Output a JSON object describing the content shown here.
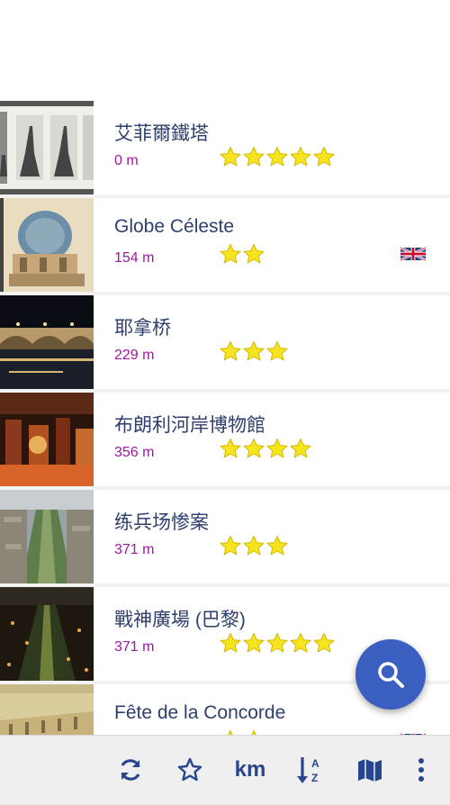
{
  "places": [
    {
      "name": "艾菲爾鐵塔",
      "distance": "0 m",
      "rating": 5,
      "flag": ""
    },
    {
      "name": "Globe Céleste",
      "distance": "154 m",
      "rating": 2,
      "flag": "uk-flag-icon"
    },
    {
      "name": "耶拿桥",
      "distance": "229 m",
      "rating": 3,
      "flag": ""
    },
    {
      "name": "布朗利河岸博物館",
      "distance": "356 m",
      "rating": 4,
      "flag": ""
    },
    {
      "name": "练兵场惨案",
      "distance": "371 m",
      "rating": 3,
      "flag": ""
    },
    {
      "name": "戰神廣場 (巴黎)",
      "distance": "371 m",
      "rating": 5,
      "flag": ""
    },
    {
      "name": "Fête de la Concorde",
      "distance": "",
      "rating": 2,
      "flag": "uk-flag-icon"
    }
  ],
  "toolbar": {
    "units_label": "km",
    "icons": [
      "refresh-icon",
      "star-outline-icon",
      "sort-az-icon",
      "map-icon",
      "more-vert-icon"
    ]
  },
  "fab_icon": "search-icon",
  "colors": {
    "title": "#2e3f6e",
    "distance": "#a0179f",
    "star": "#f6e51e",
    "accent": "#3b5fc0",
    "toolbar_icon": "#27468f"
  }
}
